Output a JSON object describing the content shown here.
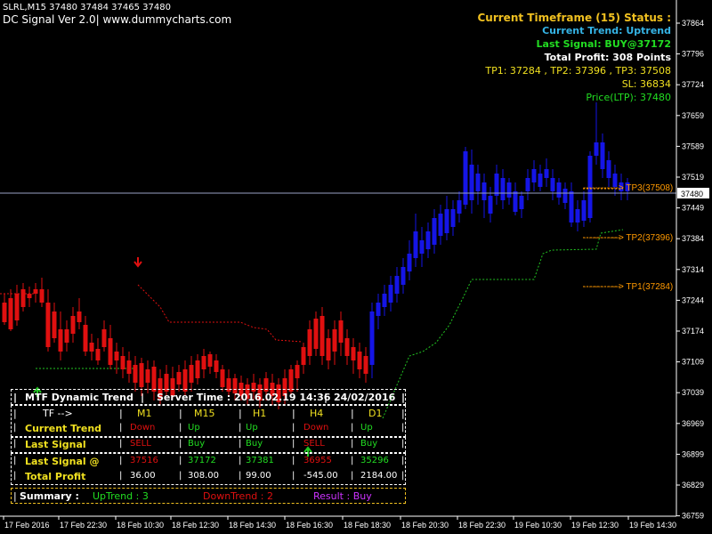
{
  "header": {
    "symbol_line": "SLRL,M15  37480 37484 37465 37480",
    "indicator_line": "DC Signal Ver 2.0| www.dummycharts.com"
  },
  "status": {
    "title": "Current Timeframe (15) Status :",
    "trend": "Current Trend: Uptrend",
    "last_signal": "Last Signal: BUY@37172",
    "total_profit": "Total Profit: 308 Points",
    "targets": "TP1: 37284 , TP2: 37396 , TP3: 37508",
    "stop_loss": "SL: 36834",
    "price": "Price(LTP): 37480"
  },
  "levels": {
    "tp3": "------------> TP3(37508)",
    "tp2": "------------> TP2(37396)",
    "tp1": "------------> TP1(37284)",
    "current_price": "37480"
  },
  "colors": {
    "bull": "#1515e6",
    "bear": "#e01010",
    "trail_bear": "#e01010",
    "trail_bull": "#22c422",
    "orange": "#ff9900",
    "grid": "#6f6f9a"
  },
  "panel": {
    "title": "MTF Dynamic Trend",
    "server_time": "Server Time :  2016.02.19 14:36",
    "date": "24/02/2016",
    "tf_label": "TF -->",
    "timeframes": [
      "M1",
      "M15",
      "H1",
      "H4",
      "D1"
    ],
    "rows": [
      {
        "label": "Current Trend",
        "values": [
          "Down",
          "Up",
          "Up",
          "Down",
          "Up"
        ]
      },
      {
        "label": "Last Signal",
        "values": [
          "SELL",
          "Buy",
          "Buy",
          "SELL",
          "Buy"
        ]
      },
      {
        "label": "Last Signal @",
        "values": [
          "37516",
          "37172",
          "37381",
          "36955",
          "35296"
        ]
      },
      {
        "label": "Total Profit",
        "values": [
          "36.00",
          "308.00",
          "99.00",
          "-545.00",
          "2184.00"
        ]
      }
    ],
    "summary_label": "Summary :",
    "uptrend": "UpTrend : 3",
    "downtrend": "DownTrend : 2",
    "result": "Result : Buy"
  },
  "chart_data": {
    "type": "candlestick",
    "symbol": "SLRL",
    "timeframe": "M15",
    "y_ticks": [
      37864,
      37796,
      37724,
      37659,
      37589,
      37519,
      37449,
      37384,
      37314,
      37244,
      37174,
      37109,
      37039,
      36969,
      36899,
      36829,
      36759
    ],
    "x_ticks": [
      "17 Feb 2016",
      "17 Feb 22:30",
      "18 Feb 10:30",
      "18 Feb 12:30",
      "18 Feb 14:30",
      "18 Feb 16:30",
      "18 Feb 18:30",
      "18 Feb 20:30",
      "18 Feb 22:30",
      "19 Feb 10:30",
      "19 Feb 12:30",
      "19 Feb 14:30"
    ],
    "ylim": [
      36750,
      37880
    ],
    "current_price": 37480
  }
}
